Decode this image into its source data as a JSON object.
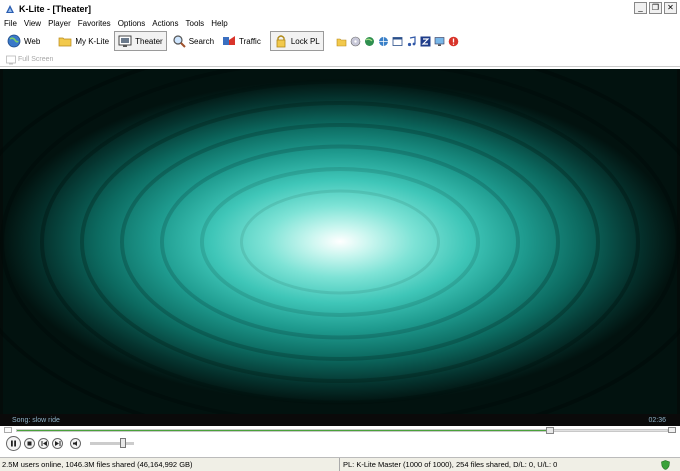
{
  "window": {
    "title": "K-Lite - [Theater]",
    "minimize": "_",
    "restore": "❐",
    "close": "✕"
  },
  "menu": [
    "File",
    "View",
    "Player",
    "Favorites",
    "Options",
    "Actions",
    "Tools",
    "Help"
  ],
  "toolbar": {
    "web": "Web",
    "my_klite": "My K-Lite",
    "theater": "Theater",
    "search": "Search",
    "traffic": "Traffic",
    "lock_pl": "Lock PL",
    "active": "Theater"
  },
  "subbar": {
    "full_screen": "Full Screen"
  },
  "player": {
    "song": "Song: slow ride",
    "time": "02:36",
    "progress": 0.82,
    "volume": 0.75
  },
  "status": {
    "left": "2.5M users online, 1046.3M files shared (46,164,992 GB)",
    "right": "PL: K-Lite Master (1000 of 1000), 254 files shared, D/L: 0, U/L: 0"
  },
  "colors": {
    "seek_fill": "#4aa13a",
    "song_text": "#8fb3c8"
  }
}
